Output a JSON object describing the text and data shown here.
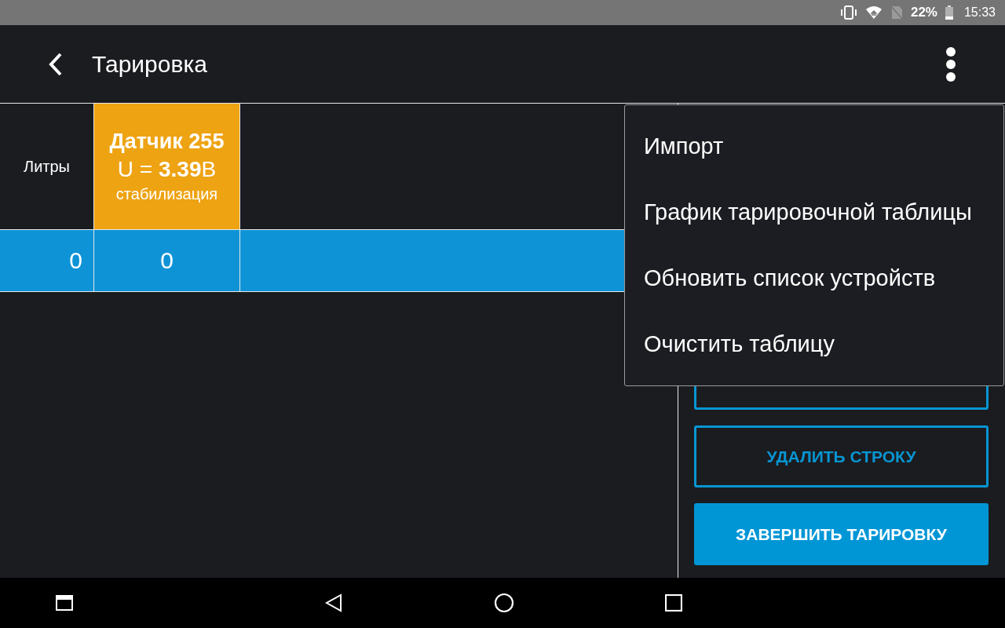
{
  "status_bar": {
    "battery": "22%",
    "time": "15:33"
  },
  "app_bar": {
    "title": "Тарировка"
  },
  "table": {
    "columns": [
      {
        "kind": "plain",
        "label": "Литры"
      },
      {
        "kind": "sensor",
        "name": "Датчик 255",
        "reading": "U = **3.39**В",
        "status": "стабилизация"
      }
    ],
    "rows": [
      {
        "selected": true,
        "cells": [
          "0",
          "0"
        ]
      }
    ]
  },
  "buttons": [
    {
      "kind": "outline"
    },
    {
      "kind": "outline",
      "label": "УДАЛИТЬ СТРОКУ"
    },
    {
      "kind": "filled",
      "label": "ЗАВЕРШИТЬ ТАРИРОВКУ"
    }
  ],
  "menu": {
    "items": [
      "Импорт",
      "График тарировочной таблицы",
      "Обновить список устройств",
      "Очистить таблицу"
    ]
  }
}
